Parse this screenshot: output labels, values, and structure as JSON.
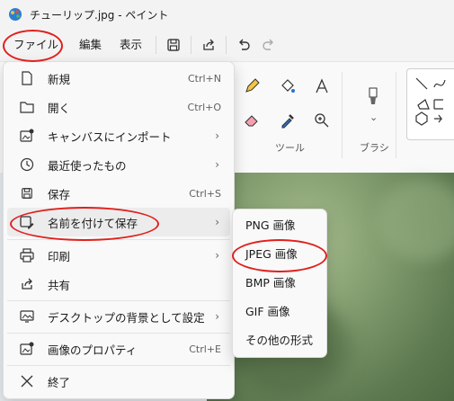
{
  "window": {
    "title": "チューリップ.jpg - ペイント",
    "app_icon": "paint-app-icon"
  },
  "menubar": {
    "file": "ファイル",
    "edit": "編集",
    "view": "表示"
  },
  "toolbar": {
    "save_icon": "save-icon",
    "share_icon": "share-icon",
    "undo_icon": "undo-icon",
    "redo_icon": "redo-icon"
  },
  "ribbon": {
    "tools_label": "ツール",
    "brushes_label": "ブラシ"
  },
  "file_menu": {
    "items": [
      {
        "label": "新規",
        "shortcut": "Ctrl+N",
        "icon": "new-file-icon"
      },
      {
        "label": "開く",
        "shortcut": "Ctrl+O",
        "icon": "open-folder-icon"
      },
      {
        "label": "キャンバスにインポート",
        "arrow": "›",
        "icon": "import-image-icon"
      },
      {
        "label": "最近使ったもの",
        "arrow": "›",
        "icon": "recent-clock-icon"
      },
      {
        "label": "保存",
        "shortcut": "Ctrl+S",
        "icon": "save-icon"
      },
      {
        "label": "名前を付けて保存",
        "arrow": "›",
        "icon": "save-as-icon"
      },
      {
        "label": "印刷",
        "arrow": "›",
        "icon": "print-icon"
      },
      {
        "label": "共有",
        "icon": "share-icon"
      },
      {
        "label": "デスクトップの背景として設定",
        "arrow": "›",
        "icon": "desktop-background-icon"
      },
      {
        "label": "画像のプロパティ",
        "shortcut": "Ctrl+E",
        "icon": "image-properties-icon"
      },
      {
        "label": "終了",
        "icon": "close-icon"
      }
    ]
  },
  "save_as_submenu": {
    "items": [
      "PNG 画像",
      "JPEG 画像",
      "BMP 画像",
      "GIF 画像",
      "その他の形式"
    ]
  },
  "colors": {
    "highlight": "#e0201c",
    "accent": "#0067c0"
  }
}
